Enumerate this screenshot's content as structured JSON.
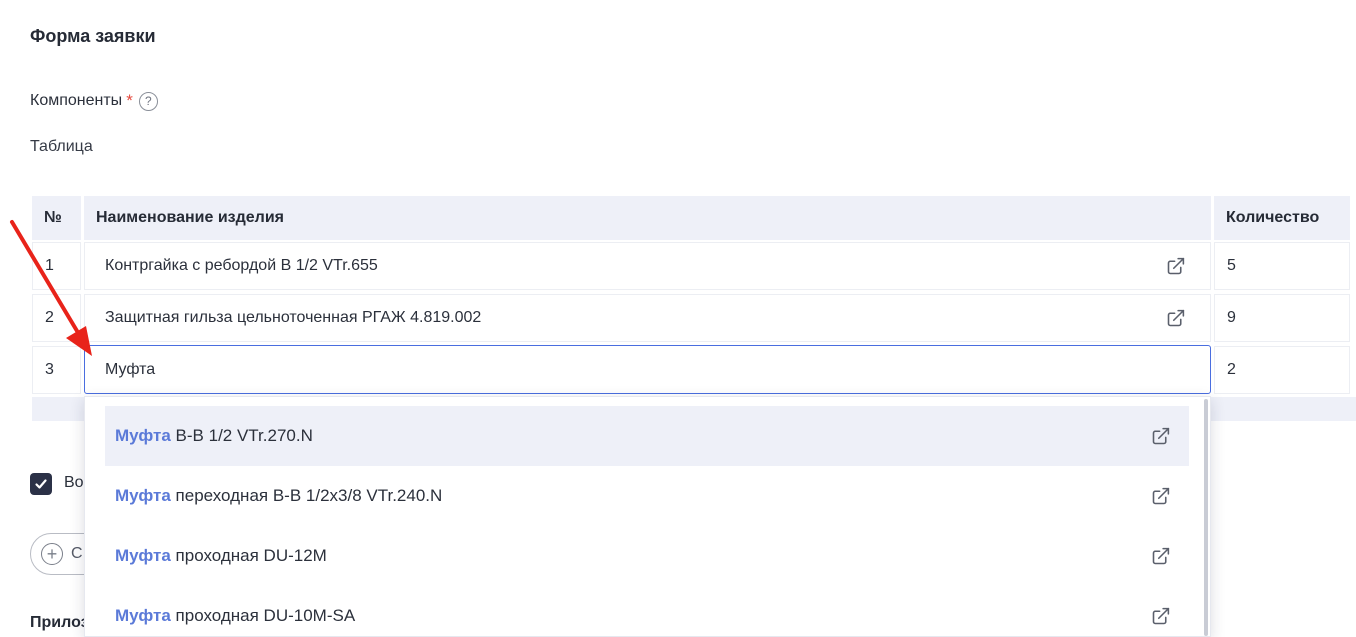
{
  "form": {
    "title": "Форма заявки",
    "components_label": "Компоненты",
    "required_mark": "*",
    "help_glyph": "?",
    "table_caption": "Таблица"
  },
  "table": {
    "headers": {
      "num": "№",
      "name": "Наименование изделия",
      "qty": "Количество"
    },
    "rows": [
      {
        "num": "1",
        "name": "Контргайка с ребордой В 1/2 VTr.655",
        "qty": "5"
      },
      {
        "num": "2",
        "name": "Защитная гильза цельноточенная РГАЖ 4.819.002",
        "qty": "9"
      },
      {
        "num": "3",
        "name": "Муфта",
        "qty": "2"
      }
    ]
  },
  "dropdown": {
    "options": [
      {
        "match": "Муфта",
        "rest": " В-В 1/2 VTr.270.N"
      },
      {
        "match": "Муфта",
        "rest": " переходная В-В 1/2х3/8 VTr.240.N"
      },
      {
        "match": "Муфта",
        "rest": " проходная DU-12M"
      },
      {
        "match": "Муфта",
        "rest": " проходная DU-10M-SA"
      }
    ]
  },
  "below": {
    "checkbox_label": "Во",
    "add_button_label": "С",
    "attachments_label": "Прилоз"
  },
  "colors": {
    "accent": "#4a6ee0",
    "highlight": "#5b7ad8",
    "header_bg": "#eef0f8",
    "required": "#e5483c",
    "annotation_arrow": "#e8231a"
  },
  "icons": {
    "external_link": "external-link-icon",
    "help": "help-icon",
    "check": "check-icon",
    "plus": "plus-circle-icon"
  }
}
